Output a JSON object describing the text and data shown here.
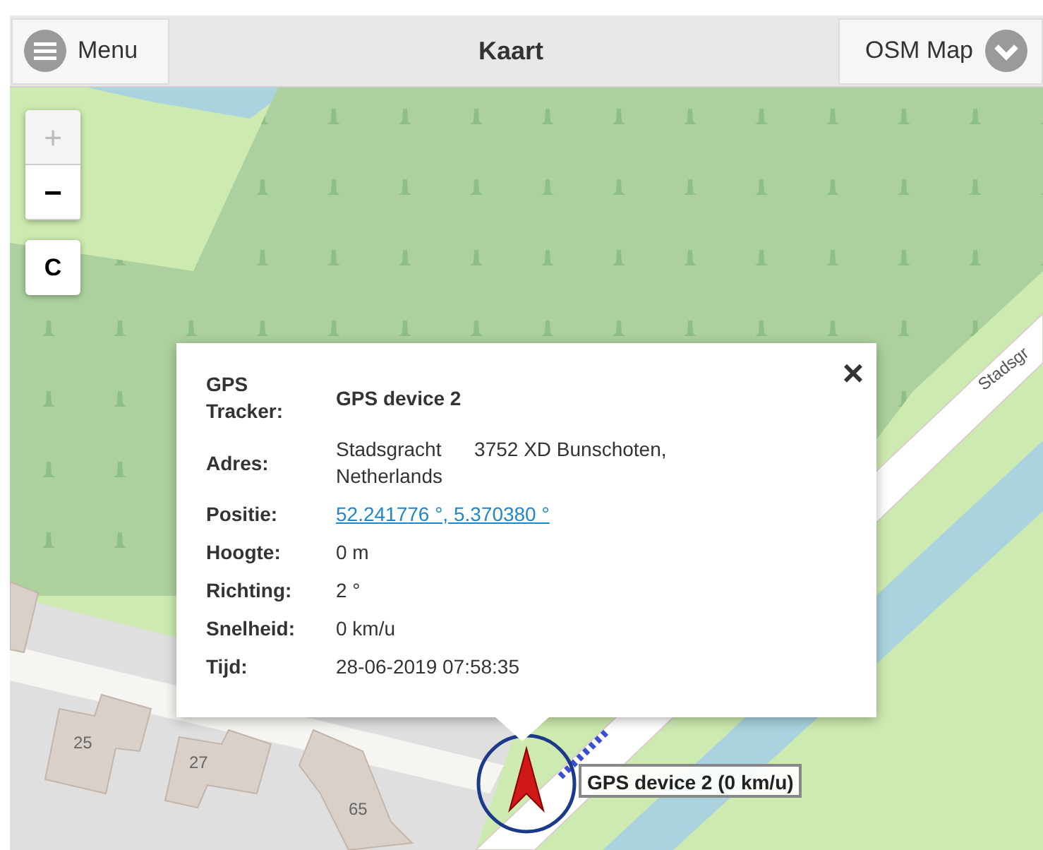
{
  "header": {
    "menu_button": "Menu",
    "title": "Kaart",
    "map_select": "OSM Map"
  },
  "zoom_controls": [
    {
      "label": "+",
      "disabled": true
    },
    {
      "label": "−",
      "disabled": false
    }
  ],
  "center_button": "C",
  "map_labels": {
    "street": "Stadsgr",
    "house_numbers": [
      "25",
      "27",
      "65"
    ]
  },
  "popup": {
    "close": "×",
    "rows": [
      {
        "label": "GPS Tracker:",
        "value": "GPS device 2",
        "kind": "bold"
      },
      {
        "label": "Adres:",
        "value": "Stadsgracht      3752 XD Bunschoten, Netherlands",
        "kind": "text"
      },
      {
        "label": "Positie:",
        "value": "52.241776 °, 5.370380 °",
        "kind": "link"
      },
      {
        "label": "Hoogte:",
        "value": "0 m",
        "kind": "text"
      },
      {
        "label": "Richting:",
        "value": "2 °",
        "kind": "text"
      },
      {
        "label": "Snelheid:",
        "value": "0 km/u",
        "kind": "text"
      },
      {
        "label": "Tijd:",
        "value": "28-06-2019 07:58:35",
        "kind": "text"
      }
    ]
  },
  "marker_label": "GPS device 2 (0 km/u)"
}
